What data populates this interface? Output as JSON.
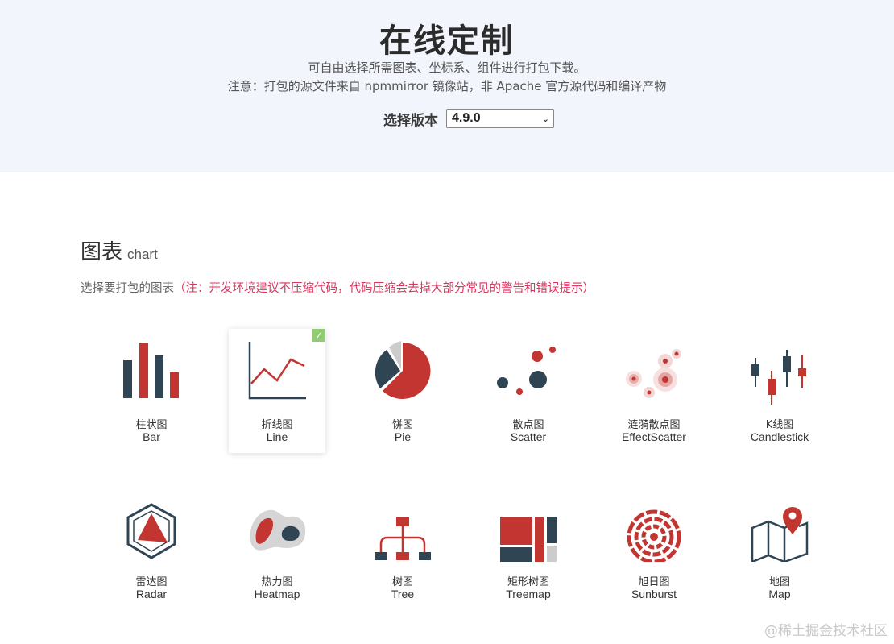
{
  "header": {
    "title": "在线定制",
    "subtitle": "可自由选择所需图表、坐标系、组件进行打包下载。",
    "notice": "注意：打包的源文件来自 npmmirror 镜像站，非 Apache 官方源代码和编译产物",
    "version_label": "选择版本",
    "version_value": "4.9.0"
  },
  "section": {
    "title_zh": "图表",
    "title_en": "chart",
    "desc": "选择要打包的图表",
    "warning": "（注：开发环境建议不压缩代码，代码压缩会去掉大部分常见的警告和错误提示）"
  },
  "charts": [
    {
      "zh": "柱状图",
      "en": "Bar",
      "icon": "bar-chart-icon",
      "selected": false
    },
    {
      "zh": "折线图",
      "en": "Line",
      "icon": "line-chart-icon",
      "selected": true
    },
    {
      "zh": "饼图",
      "en": "Pie",
      "icon": "pie-chart-icon",
      "selected": false
    },
    {
      "zh": "散点图",
      "en": "Scatter",
      "icon": "scatter-chart-icon",
      "selected": false
    },
    {
      "zh": "涟漪散点图",
      "en": "EffectScatter",
      "icon": "effect-scatter-icon",
      "selected": false
    },
    {
      "zh": "K线图",
      "en": "Candlestick",
      "icon": "candlestick-icon",
      "selected": false
    },
    {
      "zh": "雷达图",
      "en": "Radar",
      "icon": "radar-chart-icon",
      "selected": false
    },
    {
      "zh": "热力图",
      "en": "Heatmap",
      "icon": "heatmap-icon",
      "selected": false
    },
    {
      "zh": "树图",
      "en": "Tree",
      "icon": "tree-chart-icon",
      "selected": false
    },
    {
      "zh": "矩形树图",
      "en": "Treemap",
      "icon": "treemap-icon",
      "selected": false
    },
    {
      "zh": "旭日图",
      "en": "Sunburst",
      "icon": "sunburst-icon",
      "selected": false
    },
    {
      "zh": "地图",
      "en": "Map",
      "icon": "map-icon",
      "selected": false
    }
  ],
  "colors": {
    "red": "#c23531",
    "navy": "#2f4554",
    "gray": "#cccccc",
    "check_green": "#91cc75",
    "warning": "#d9365e"
  },
  "watermark": "@稀土掘金技术社区"
}
